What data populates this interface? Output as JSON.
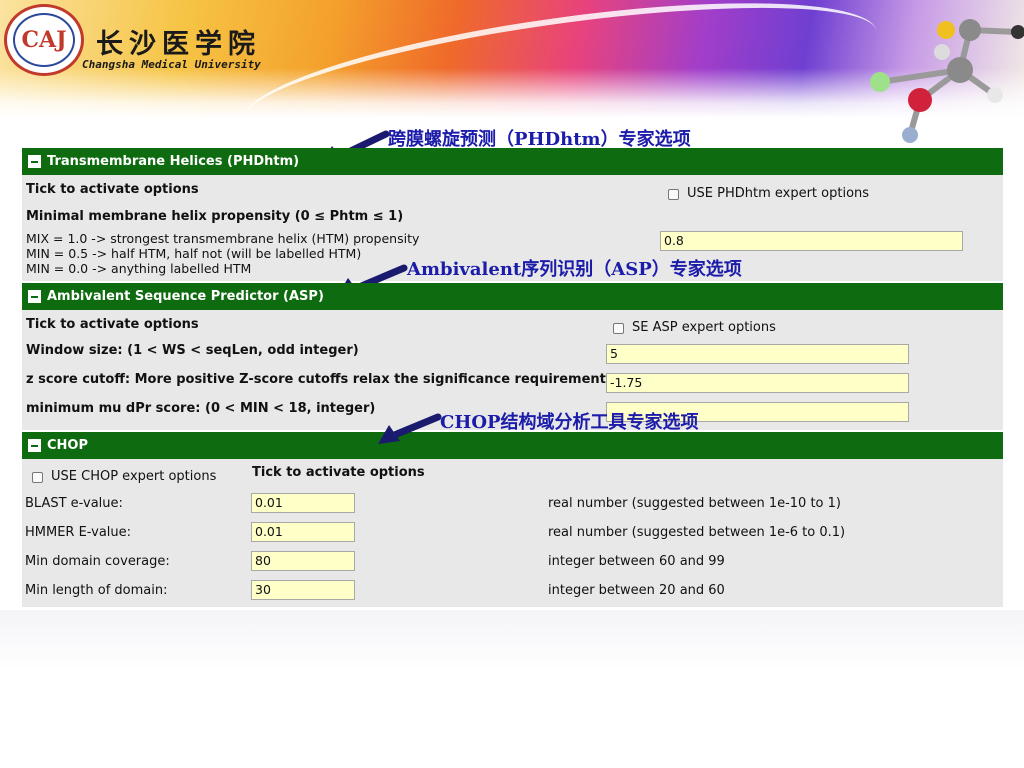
{
  "header": {
    "university_cn": "长沙医学院",
    "university_en": "Changsha Medical University",
    "logo_text": "CAJ"
  },
  "annotations": {
    "phdhtm": "跨膜螺旋预测（PHDhtm）专家选项",
    "asp": "Ambivalent序列识别（ASP）专家选项",
    "chop": "CHOP结构域分析工具专家选项"
  },
  "phdhtm": {
    "title": "Transmembrane Helices (PHDhtm)",
    "tick_label": "Tick to activate options",
    "checkbox_label": "USE PHDhtm expert options",
    "propensity_label": "Minimal membrane helix propensity (0 ≤ Phtm ≤ 1)",
    "desc_lines": [
      "MIX = 1.0 -> strongest transmembrane helix (HTM) propensity",
      "MIN = 0.5 -> half HTM, half not (will be labelled HTM)",
      "MIN = 0.0 -> anything labelled HTM"
    ],
    "propensity_value": "0.8"
  },
  "asp": {
    "title": "Ambivalent Sequence Predictor (ASP)",
    "tick_label": "Tick to activate options",
    "checkbox_label": "SE ASP expert options",
    "window_label": "Window size: (1 < WS < seqLen, odd integer)",
    "window_value": "5",
    "zscore_label": "z score cutoff: More positive Z-score cutoffs relax the significance requirement",
    "zscore_value": "-1.75",
    "mindpr_label": "minimum mu dPr score: (0 < MIN < 18, integer)",
    "mindpr_value": ""
  },
  "chop": {
    "title": "CHOP",
    "checkbox_label": "USE CHOP expert options",
    "tick_label": "Tick to activate options",
    "rows": [
      {
        "label": "BLAST e-value:",
        "value": "0.01",
        "hint": "real number (suggested between 1e-10 to 1)"
      },
      {
        "label": "HMMER E-value:",
        "value": "0.01",
        "hint": "real number (suggested between 1e-6 to 0.1)"
      },
      {
        "label": "Min domain coverage:",
        "value": "80",
        "hint": "integer between 60 and 99"
      },
      {
        "label": "Min length of domain:",
        "value": "30",
        "hint": "integer between 20 and 60"
      }
    ]
  },
  "colors": {
    "bar_green": "#0f6b0f",
    "input_yellow": "#ffffc8",
    "annotation_blue": "#1c1caa",
    "arrow_navy": "#1a1a6e"
  }
}
